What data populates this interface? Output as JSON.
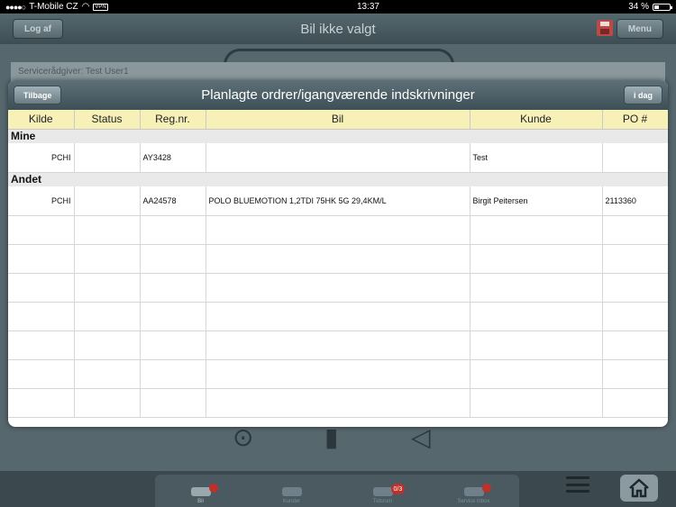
{
  "status_bar": {
    "signal_dots": "●●●●○",
    "carrier": "T-Mobile CZ",
    "vpn": "VPN",
    "time": "13:37",
    "battery_text": "34 %",
    "battery_level": 0.34
  },
  "header": {
    "title": "Bil ikke valgt",
    "logout_label": "Log af",
    "menu_label": "Menu"
  },
  "background": {
    "advisor_text": "Servicerådgiver: Test User1"
  },
  "tabbar": {
    "tabs": [
      {
        "label": "Bil",
        "active": true,
        "badge": ""
      },
      {
        "label": "Kunder",
        "active": false,
        "badge": ""
      },
      {
        "label": "Tidsrum",
        "active": false,
        "badge": "0/3"
      },
      {
        "label": "Service inbox",
        "active": false,
        "badge": ""
      }
    ]
  },
  "modal": {
    "title": "Planlagte ordrer/igangværende indskrivninger",
    "back_label": "Tilbage",
    "today_label": "i dag",
    "columns": [
      "Kilde",
      "Status",
      "Reg.nr.",
      "Bil",
      "Kunde",
      "PO #"
    ],
    "groups": [
      {
        "name": "Mine",
        "rows": [
          {
            "kilde": "PCHI",
            "status": "",
            "regnr": "AY3428",
            "bil": "",
            "kunde": "Test",
            "po": ""
          }
        ]
      },
      {
        "name": "Andet",
        "rows": [
          {
            "kilde": "PCHI",
            "status": "",
            "regnr": "AA24578",
            "bil": "POLO BLUEMOTION 1,2TDI 75HK 5G 29,4KM/L",
            "kunde": "Birgit Peitersen",
            "po": "2113360"
          }
        ]
      }
    ]
  }
}
